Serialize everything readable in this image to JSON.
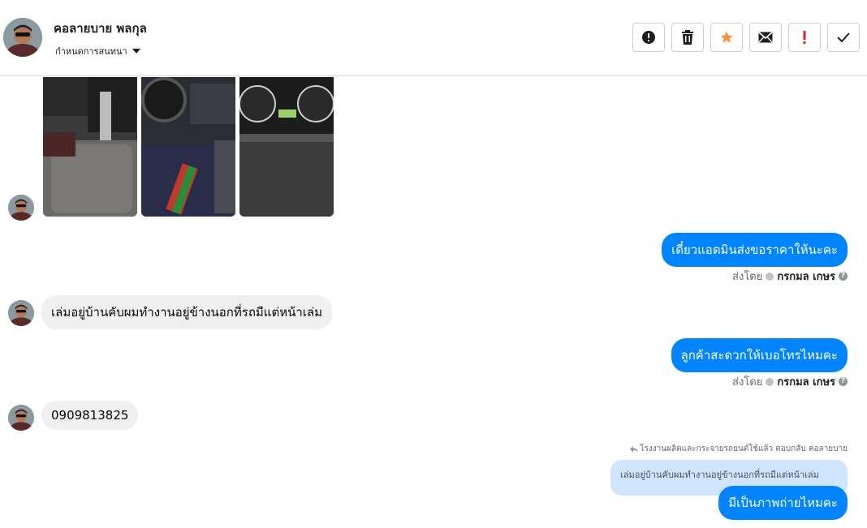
{
  "header": {
    "contact_name": "คอลายบาย พลกุล",
    "assign_label": "กำหนดการสนทนา"
  },
  "toolbar": {
    "buttons": [
      {
        "name": "spam-button",
        "icon": "alert-circle-icon"
      },
      {
        "name": "delete-button",
        "icon": "trash-icon"
      },
      {
        "name": "star-button",
        "icon": "star-icon"
      },
      {
        "name": "mark-unread-button",
        "icon": "envelope-icon"
      },
      {
        "name": "follow-up-button",
        "icon": "exclamation-icon"
      },
      {
        "name": "done-button",
        "icon": "check-icon"
      }
    ],
    "accent_star": "#f7923a",
    "accent_exclaim": "#e02020"
  },
  "messages": {
    "m1": {
      "text": "เดี๋ยวแอดมินส่งขอราคาให้นะคะ"
    },
    "m1_sent": {
      "prefix": "ส่งโดย",
      "agent": "กรกมล เกษร"
    },
    "m2": {
      "text": "เล่มอยู่บ้านคับผมทำงานอยู่ข้างนอกที่รถมีแต่หน้าเล่ม"
    },
    "m3": {
      "text": "ลูกค้าสะดวกให้เบอโทรไหมคะ"
    },
    "m3_sent": {
      "prefix": "ส่งโดย",
      "agent": "กรกมล เกษร"
    },
    "m4": {
      "text": "0909813825"
    },
    "reply_note": "โรงงานผลิตและกระจายรถยนต์ใช้แล้ว ตอบกลับ คอลายบาย",
    "quoted_text": "เล่มอยู่บ้านคับผมทำงานอยู่ข้างนอกที่รถมีแต่หน้าเล่ม",
    "m5": {
      "text": "มีเป็นภาพถ่ายไหมคะ"
    }
  },
  "colors": {
    "outgoing_bubble": "#0084ff",
    "incoming_bubble": "#f0f0f0",
    "quoted_bubble": "#cfe5ff"
  }
}
